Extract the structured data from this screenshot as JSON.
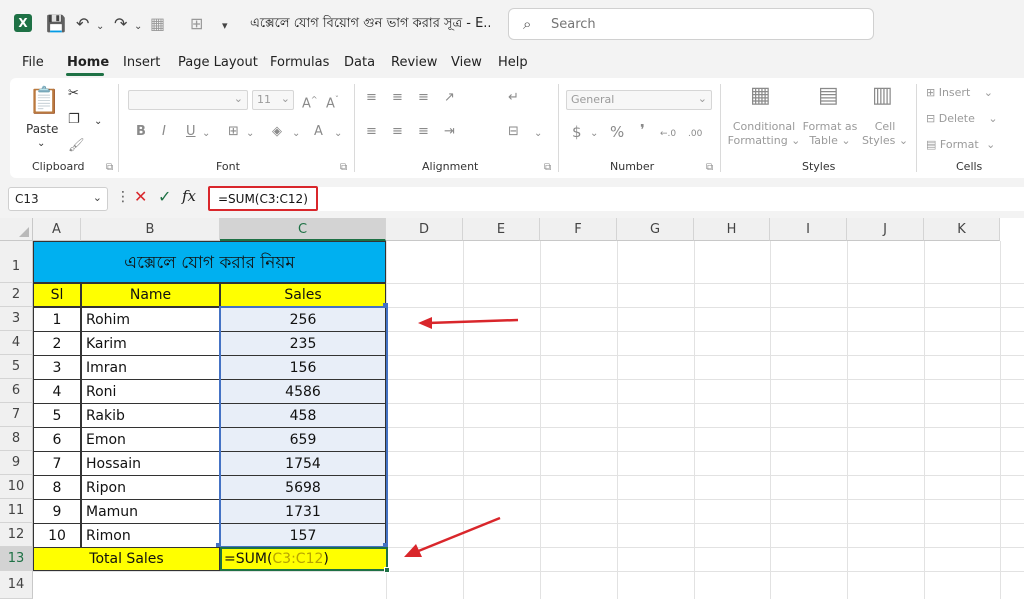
{
  "titlebar": {
    "doc_title": "এক্সেলে যোগ বিয়োগ গুন ভাগ করার সূত্র - E...",
    "search_placeholder": "Search"
  },
  "menu": [
    "File",
    "Home",
    "Insert",
    "Page Layout",
    "Formulas",
    "Data",
    "Review",
    "View",
    "Help"
  ],
  "ribbon": {
    "paste": "Paste",
    "groups": [
      "Clipboard",
      "Font",
      "Alignment",
      "Number",
      "Styles",
      "Cells"
    ],
    "font_size": "11",
    "number_format": "General",
    "conditional": [
      "Conditional",
      "Formatting"
    ],
    "format_as": [
      "Format as",
      "Table"
    ],
    "cell_styles": [
      "Cell",
      "Styles"
    ],
    "insert": "Insert",
    "delete": "Delete",
    "format": "Format",
    "bold": "B",
    "italic": "I",
    "underline": "U",
    "dec_buttons": [
      "←.0",
      ".00"
    ]
  },
  "formula_bar": {
    "name_box": "C13",
    "fx": "fx",
    "formula": "=SUM(C3:C12)"
  },
  "columns": [
    "A",
    "B",
    "C",
    "D",
    "E",
    "F",
    "G",
    "H",
    "I",
    "J",
    "K"
  ],
  "rows": [
    "1",
    "2",
    "3",
    "4",
    "5",
    "6",
    "7",
    "8",
    "9",
    "10",
    "11",
    "12",
    "13",
    "14"
  ],
  "sheet": {
    "title": "এক্সেলে যোগ করার নিয়ম",
    "headers": [
      "Sl",
      "Name",
      "Sales"
    ],
    "data": [
      {
        "sl": "1",
        "name": "Rohim",
        "sales": "256"
      },
      {
        "sl": "2",
        "name": "Karim",
        "sales": "235"
      },
      {
        "sl": "3",
        "name": "Imran",
        "sales": "156"
      },
      {
        "sl": "4",
        "name": "Roni",
        "sales": "4586"
      },
      {
        "sl": "5",
        "name": "Rakib",
        "sales": "458"
      },
      {
        "sl": "6",
        "name": "Emon",
        "sales": "659"
      },
      {
        "sl": "7",
        "name": "Hossain",
        "sales": "1754"
      },
      {
        "sl": "8",
        "name": "Ripon",
        "sales": "5698"
      },
      {
        "sl": "9",
        "name": "Mamun",
        "sales": "1731"
      },
      {
        "sl": "10",
        "name": "Rimon",
        "sales": "157"
      }
    ],
    "total_label": "Total Sales",
    "total_formula_prefix": "=SUM(",
    "total_formula_range": "C3:C12",
    "total_formula_suffix": ")"
  },
  "colors": {
    "title_fill": "#00b0f0",
    "header_fill": "#ffff00",
    "selection_fill": "#e8eef8",
    "range_ref": "#b7a400",
    "accent_green": "#1e7145",
    "annotation_red": "#d9262b"
  }
}
